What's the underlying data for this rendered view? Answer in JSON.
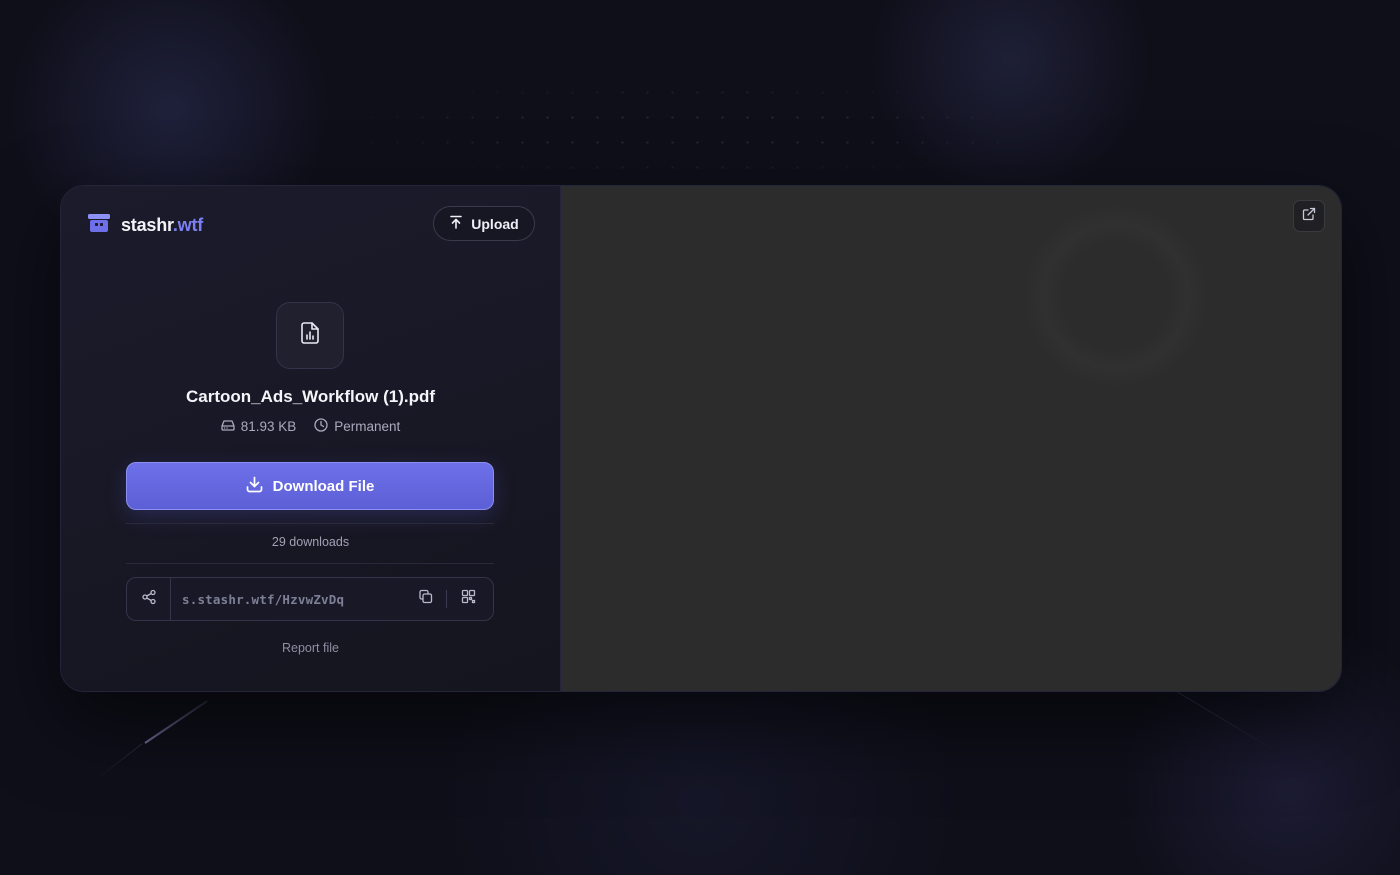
{
  "brand": {
    "name_main": "stashr",
    "name_accent": ".wtf"
  },
  "header": {
    "upload_label": "Upload"
  },
  "file": {
    "name": "Cartoon_Ads_Workflow (1).pdf",
    "size": "81.93 KB",
    "expiry": "Permanent"
  },
  "actions": {
    "download_label": "Download File"
  },
  "stats": {
    "downloads_text": "29 downloads"
  },
  "share": {
    "url": "s.stashr.wtf/HzvwZvDq"
  },
  "footer": {
    "report_label": "Report file"
  },
  "colors": {
    "accent": "#6d70e8",
    "brand_accent": "#7b7ff2",
    "background": "#0f0f1a",
    "preview_bg": "#2c2c2c"
  },
  "icons": {
    "logo": "box-icon",
    "upload": "arrow-up-icon",
    "file": "file-chart-icon",
    "size": "hard-drive-icon",
    "expiry": "clock-icon",
    "download": "download-icon",
    "share": "share-icon",
    "copy": "copy-icon",
    "qr": "qr-code-icon",
    "external": "external-link-icon"
  }
}
